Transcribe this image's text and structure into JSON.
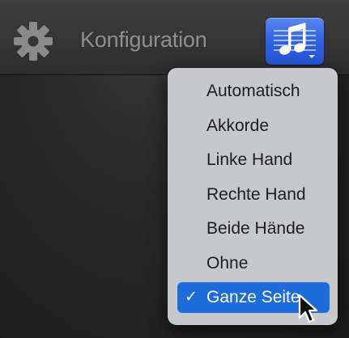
{
  "toolbar": {
    "settings_icon": "gear-icon",
    "title": "Konfiguration",
    "score_button_icon": "music-score-icon"
  },
  "colors": {
    "accent": "#1d6cdc",
    "menu_background": "#c6c8cb",
    "button_blue": "#2c5fe0"
  },
  "menu": {
    "items": [
      {
        "label": "Automatisch",
        "selected": false
      },
      {
        "label": "Akkorde",
        "selected": false
      },
      {
        "label": "Linke Hand",
        "selected": false
      },
      {
        "label": "Rechte Hand",
        "selected": false
      },
      {
        "label": "Beide Hände",
        "selected": false
      },
      {
        "label": "Ohne",
        "selected": false
      },
      {
        "label": "Ganze Seite",
        "selected": true,
        "checkmark": "✓"
      }
    ]
  }
}
